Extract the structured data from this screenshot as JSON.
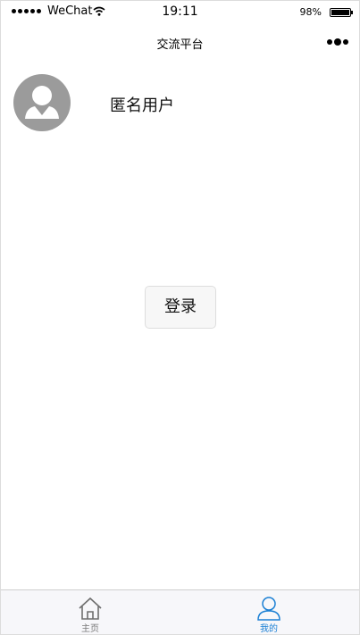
{
  "status_bar": {
    "carrier": "WeChat",
    "time": "19:11",
    "battery_percent": "98%",
    "battery_level": 0.98
  },
  "nav": {
    "title": "交流平台",
    "more_icon": "more-dots-icon"
  },
  "profile": {
    "avatar_icon": "default-user-avatar-icon",
    "username": "匿名用户"
  },
  "login": {
    "label": "登录"
  },
  "tabs": [
    {
      "label": "主页",
      "icon": "home-icon",
      "active": false
    },
    {
      "label": "我的",
      "icon": "user-icon",
      "active": true
    }
  ],
  "colors": {
    "active_tab": "#1a7fd4",
    "inactive_tab": "#7a7a7a",
    "avatar_bg": "#9b9b9b"
  }
}
